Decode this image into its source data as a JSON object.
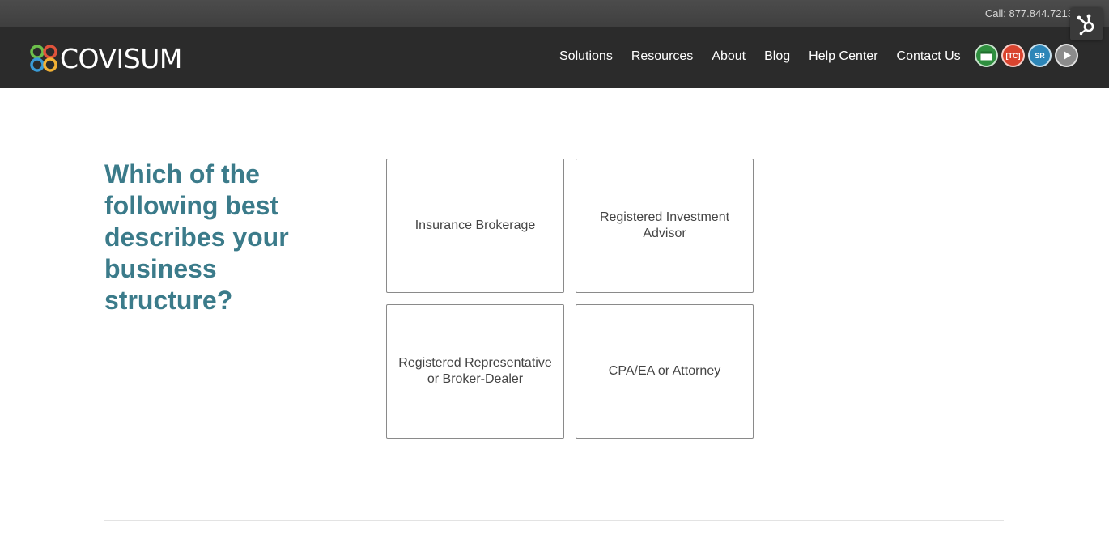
{
  "topbar": {
    "call_text": "Call: 877.844.7213"
  },
  "brand": {
    "name": "COVISUM",
    "logo_colors": [
      "#6cbf4b",
      "#e0533b",
      "#3a9bd6",
      "#f2b134"
    ]
  },
  "nav": {
    "items": [
      "Solutions",
      "Resources",
      "About",
      "Blog",
      "Help Center",
      "Contact Us"
    ]
  },
  "badges": [
    {
      "label": "",
      "icon": "calendar-icon",
      "color": "#2f8f3f"
    },
    {
      "label": "[TC]",
      "icon": "tc-icon",
      "color": "#d9442f"
    },
    {
      "label": "SR",
      "icon": "sr-icon",
      "color": "#2d86b8"
    },
    {
      "label": "",
      "icon": "play-icon",
      "color": "#8c8c8c"
    }
  ],
  "main": {
    "question": "Which of the following best describes your business structure?",
    "options": [
      "Insurance Brokerage",
      "Registered Investment Advisor",
      "Registered Representative or Broker-Dealer",
      "CPA/EA or Attorney"
    ]
  }
}
